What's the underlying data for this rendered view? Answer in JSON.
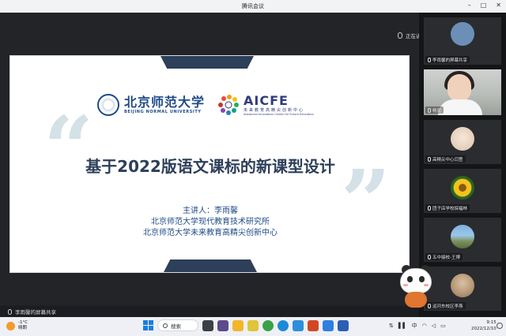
{
  "window": {
    "title": "腾讯会议"
  },
  "meeting": {
    "speaking_text": "正在讲话: 李雨馨;",
    "share_label": "李雨馨的屏幕共享"
  },
  "slide": {
    "bnu_cn": "北京师范大学",
    "bnu_en": "BEIJING NORMAL UNIVERSITY",
    "aicfe_big": "AICFE",
    "aicfe_cn": "未来教育高精尖创新中心",
    "aicfe_en": "Advanced Innovation Center for Future Education",
    "quote_open": "“",
    "quote_close": "”",
    "title": "基于2022版语文课标的新课型设计",
    "presenter_line1": "主讲人：李雨馨",
    "presenter_line2": "北京师范大学现代教育技术研究所",
    "presenter_line3": "北京师范大学未来教育高精尖创新中心"
  },
  "participants": [
    {
      "name": "李雨馨的屏幕共享"
    },
    {
      "name": "杨蓝"
    },
    {
      "name": "高精尖中心闫萱"
    },
    {
      "name": "团子店学校探福林"
    },
    {
      "name": "五中接校-王博"
    },
    {
      "name": "运河东校区李燕"
    }
  ],
  "taskbar": {
    "weather_temp": "-1°C",
    "weather_desc": "晴朗",
    "search_label": "搜索",
    "tray_lang": "中",
    "time": "9:15",
    "date": "2022/12/10"
  },
  "colors": {
    "slide_navy": "#2d3f59",
    "bnu_blue": "#1e4a86",
    "quote_color": "#d4e1e7",
    "taskbar_bg": "#eef0f6"
  }
}
